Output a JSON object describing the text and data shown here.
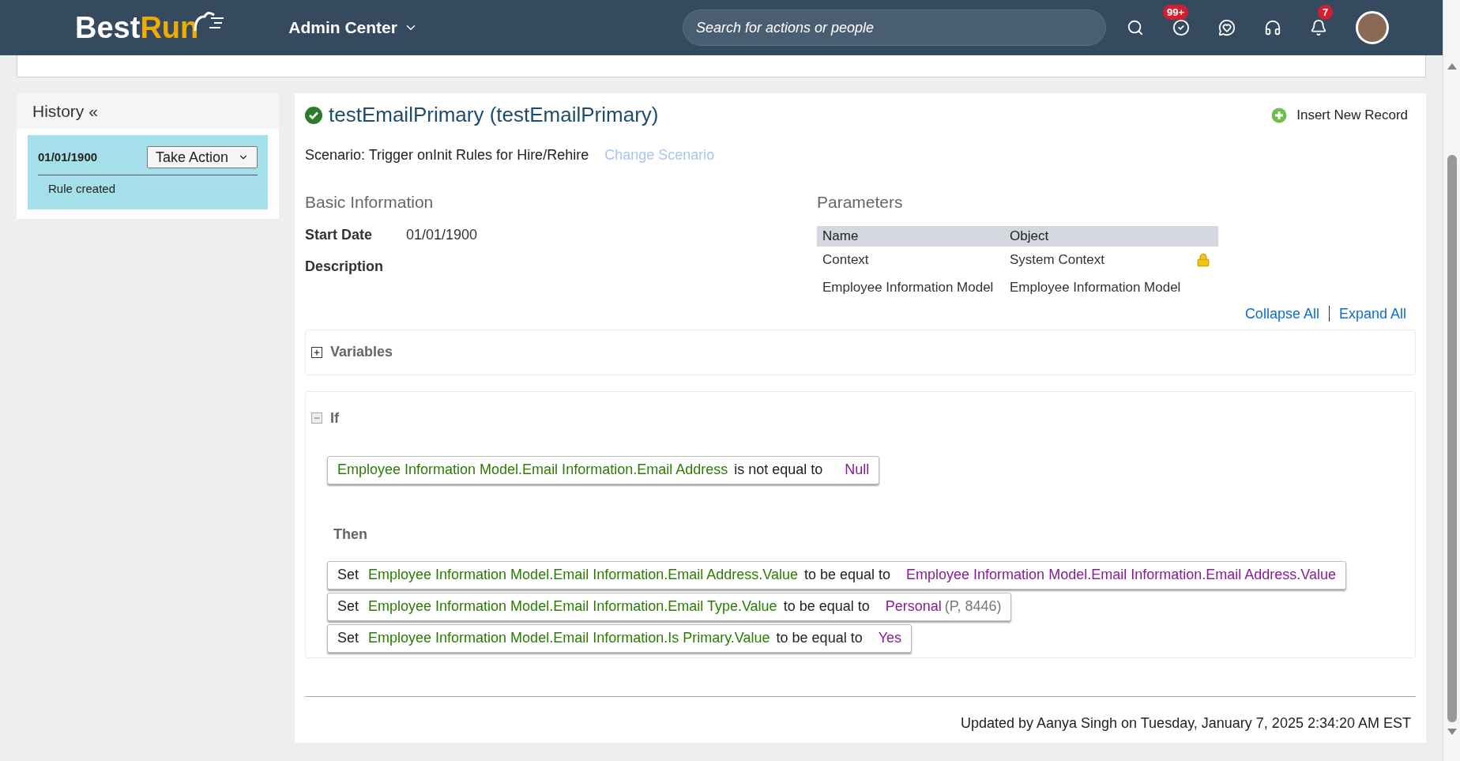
{
  "header": {
    "logo": {
      "first": "Best",
      "second": "Run"
    },
    "module": "Admin Center",
    "search": {
      "placeholder": "Search for actions or people"
    },
    "todo_badge": "99+",
    "notification_badge": "7"
  },
  "history": {
    "title": "History «",
    "entries": [
      {
        "date": "01/01/1900",
        "action": "Take Action",
        "note": "Rule created",
        "selected": true
      }
    ]
  },
  "rule": {
    "title": "testEmailPrimary (testEmailPrimary)",
    "valid": true,
    "insert_button": "Insert New Record",
    "scenario": "Scenario: Trigger onInit Rules for Hire/Rehire",
    "change_scenario": "Change Scenario",
    "basic_info": {
      "heading": "Basic Information",
      "fields": [
        {
          "label": "Start Date",
          "value": "01/01/1900"
        },
        {
          "label": "Description"
        }
      ]
    },
    "parameters": {
      "heading": "Parameters",
      "columns": [
        "Name",
        "Object"
      ],
      "rows": [
        {
          "name": "Context",
          "object": "System Context",
          "locked": true
        },
        {
          "name": "Employee Information Model",
          "object": "Employee Information Model",
          "locked": false
        }
      ]
    },
    "collapse_all": "Collapse All",
    "expand_all": "Expand All",
    "variables": {
      "title": "Variables",
      "expanded": false
    },
    "if_block": {
      "title": "If",
      "expanded": true,
      "conditions": [
        {
          "left": "Employee Information Model.Email Information.Email Address",
          "operator": "is not equal to",
          "right": "Null"
        }
      ],
      "then_title": "Then",
      "actions": [
        {
          "verb": "Set",
          "target": "Employee Information Model.Email Information.Email Address.Value",
          "operator": "to be equal to",
          "value": "Employee Information Model.Email Information.Email Address.Value"
        },
        {
          "verb": "Set",
          "target": "Employee Information Model.Email Information.Email Type.Value",
          "operator": "to be equal to",
          "value": "Personal",
          "note": "(P, 8446)"
        },
        {
          "verb": "Set",
          "target": "Employee Information Model.Email Information.Is Primary.Value",
          "operator": "to be equal to",
          "value": "Yes"
        }
      ]
    },
    "footer": "Updated by Aanya Singh on Tuesday, January 7, 2025 2:34:20 AM EST"
  }
}
